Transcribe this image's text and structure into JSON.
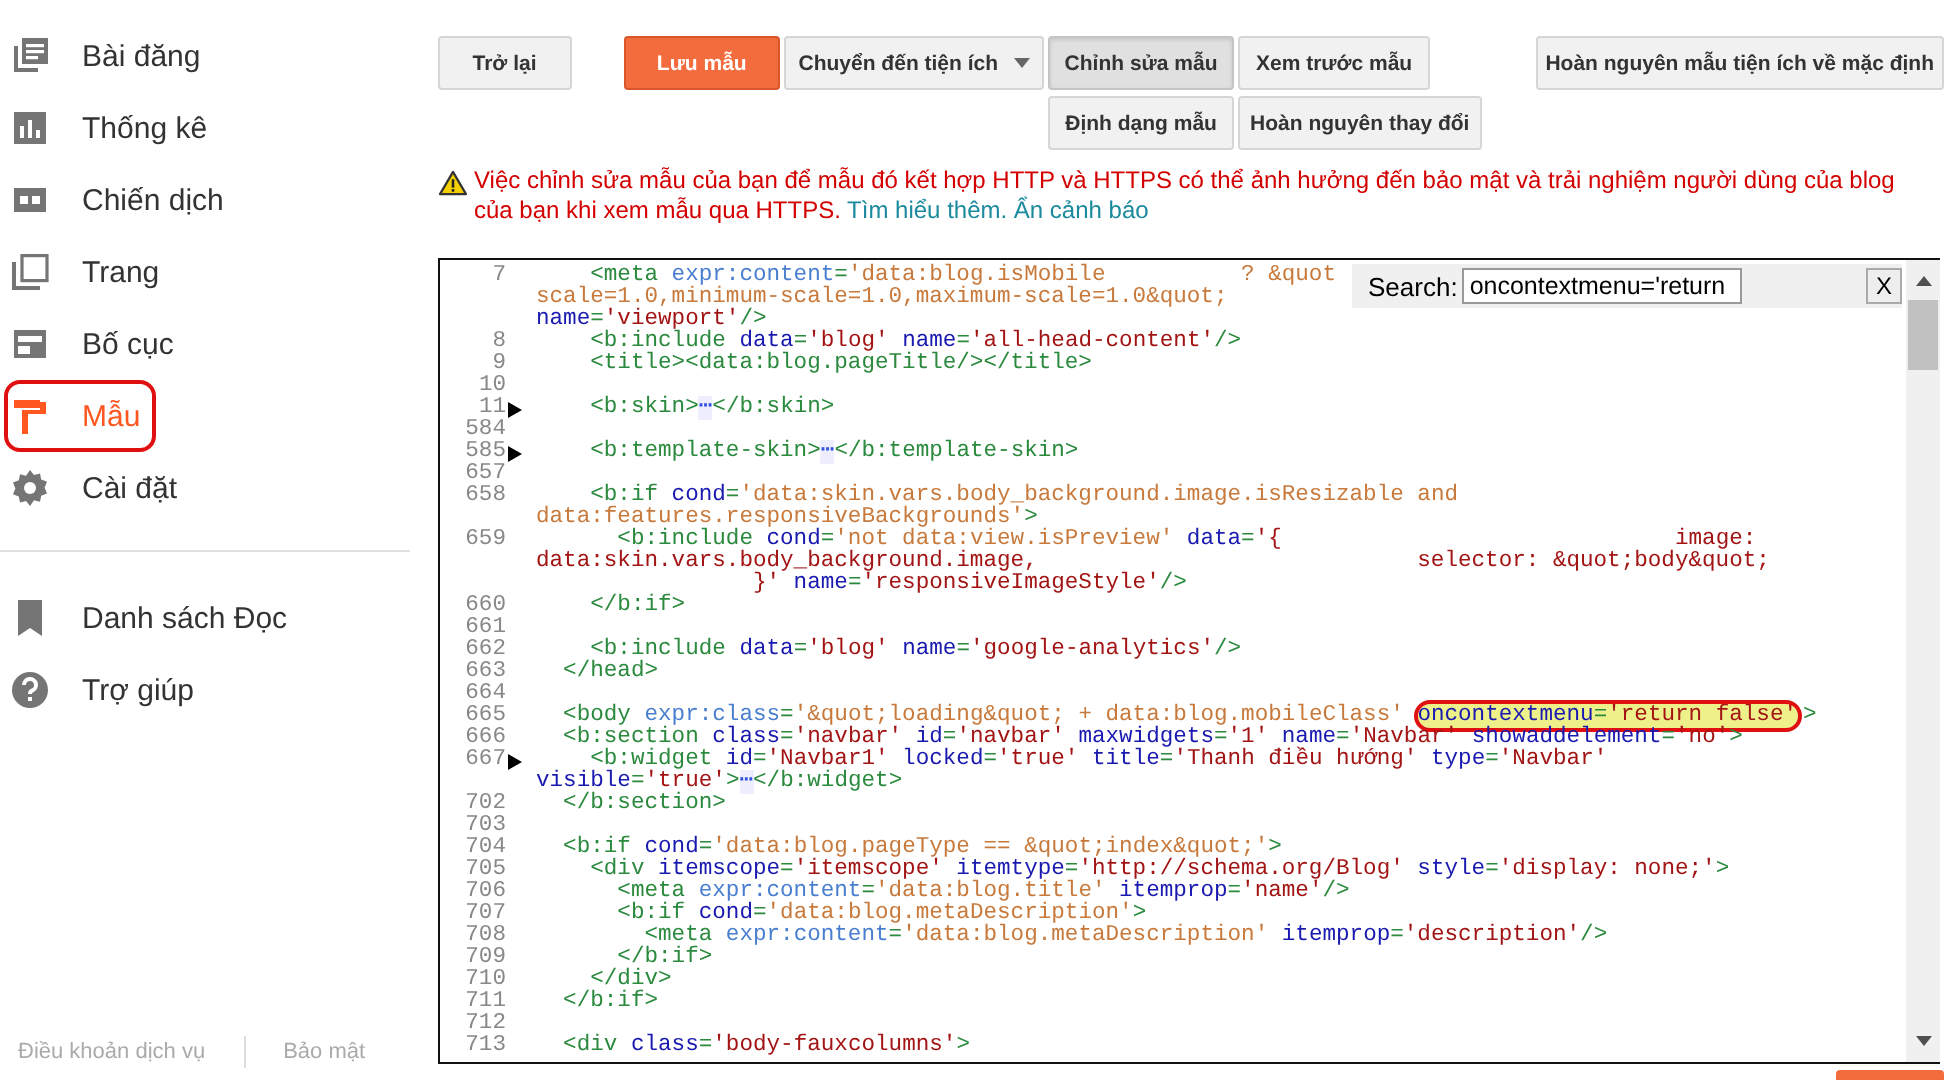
{
  "sidebar": {
    "items": [
      {
        "label": "Bài đăng",
        "selected": false,
        "circled": false
      },
      {
        "label": "Thống kê",
        "selected": false,
        "circled": false
      },
      {
        "label": "Chiến dịch",
        "selected": false,
        "circled": false
      },
      {
        "label": "Trang",
        "selected": false,
        "circled": false
      },
      {
        "label": "Bố cục",
        "selected": false,
        "circled": false
      },
      {
        "label": "Mẫu",
        "selected": true,
        "circled": true
      },
      {
        "label": "Cài đặt",
        "selected": false,
        "circled": false
      }
    ],
    "secondary_items": [
      {
        "label": "Danh sách Đọc"
      },
      {
        "label": "Trợ giúp"
      }
    ],
    "footer_links": [
      "Điều khoản dịch vụ",
      "Bảo mật"
    ]
  },
  "toolbar": {
    "back": "Trở lại",
    "save": "Lưu mẫu",
    "jump": "Chuyển đến tiện ích",
    "modes": [
      {
        "label": "Chỉnh sửa mẫu",
        "selected": true
      },
      {
        "label": "Xem trước mẫu",
        "selected": false
      }
    ],
    "format": "Định dạng mẫu",
    "revert": "Hoàn nguyên thay đổi",
    "reset_widgets": "Hoàn nguyên mẫu tiện ích về mặc định"
  },
  "warning": {
    "text": "Việc chỉnh sửa mẫu của bạn để mẫu đó kết hợp HTTP và HTTPS có thể ảnh hưởng đến bảo mật và trải nghiệm người dùng của blog của bạn khi xem mẫu qua HTTPS.",
    "learn_more": "Tìm hiểu thêm.",
    "hide": "Ẩn cảnh báo"
  },
  "search": {
    "label": "Search:",
    "value": "oncontextmenu='return",
    "close": "X"
  },
  "code_lines": [
    {
      "number": "7",
      "folded": false,
      "rows": [
        {
          "segments": [
            {
              "kind": "tag",
              "text": "    <meta"
            },
            {
              "kind": "eattr",
              "text": " expr:content"
            },
            {
              "kind": "tag",
              "text": "="
            },
            {
              "kind": "expr",
              "text": "'data:blog.isMobile          ? &quot"
            }
          ]
        },
        {
          "segments": [
            {
              "kind": "expr",
              "text": "scale=1.0,minimum-scale=1.0,maximum-scale=1.0&quot;"
            }
          ]
        },
        {
          "segments": [
            {
              "kind": "attr",
              "text": "name"
            },
            {
              "kind": "tag",
              "text": "="
            },
            {
              "kind": "str",
              "text": "'viewport'"
            },
            {
              "kind": "tag",
              "text": "/>"
            }
          ]
        }
      ]
    },
    {
      "number": "8",
      "folded": false,
      "rows": [
        {
          "segments": [
            {
              "kind": "tag",
              "text": "    <b:include"
            },
            {
              "kind": "attr",
              "text": " data"
            },
            {
              "kind": "tag",
              "text": "="
            },
            {
              "kind": "str",
              "text": "'blog'"
            },
            {
              "kind": "attr",
              "text": " name"
            },
            {
              "kind": "tag",
              "text": "="
            },
            {
              "kind": "str",
              "text": "'all-head-content'"
            },
            {
              "kind": "tag",
              "text": "/>"
            }
          ]
        }
      ]
    },
    {
      "number": "9",
      "folded": false,
      "rows": [
        {
          "segments": [
            {
              "kind": "tag",
              "text": "    <title><data:blog.pageTitle/></title>"
            }
          ]
        }
      ]
    },
    {
      "number": "10",
      "folded": false
    },
    {
      "number": "11",
      "folded": true,
      "rows": [
        {
          "segments": [
            {
              "kind": "tag",
              "text": "    <b:skin>"
            },
            {
              "kind": "fold",
              "text": "⋯"
            },
            {
              "kind": "tag",
              "text": "</b:skin>"
            }
          ]
        }
      ]
    },
    {
      "number": "584",
      "folded": false
    },
    {
      "number": "585",
      "folded": true,
      "rows": [
        {
          "segments": [
            {
              "kind": "tag",
              "text": "    <b:template-skin>"
            },
            {
              "kind": "fold",
              "text": "⋯"
            },
            {
              "kind": "tag",
              "text": "</b:template-skin>"
            }
          ]
        }
      ]
    },
    {
      "number": "657",
      "folded": false
    },
    {
      "number": "658",
      "folded": false,
      "rows": [
        {
          "segments": [
            {
              "kind": "tag",
              "text": "    <b:if"
            },
            {
              "kind": "attr",
              "text": " cond"
            },
            {
              "kind": "tag",
              "text": "="
            },
            {
              "kind": "expr",
              "text": "'data:skin.vars.body_background.image.isResizable and"
            }
          ]
        },
        {
          "segments": [
            {
              "kind": "expr",
              "text": "data:features.responsiveBackgrounds'"
            },
            {
              "kind": "tag",
              "text": ">"
            }
          ]
        }
      ]
    },
    {
      "number": "659",
      "folded": false,
      "rows": [
        {
          "segments": [
            {
              "kind": "tag",
              "text": "      <b:include"
            },
            {
              "kind": "attr",
              "text": " cond"
            },
            {
              "kind": "tag",
              "text": "="
            },
            {
              "kind": "expr",
              "text": "'not data:view.isPreview'"
            },
            {
              "kind": "attr",
              "text": " data"
            },
            {
              "kind": "tag",
              "text": "="
            },
            {
              "kind": "str",
              "text": "'{                             image:"
            }
          ]
        },
        {
          "segments": [
            {
              "kind": "str",
              "text": "data:skin.vars.body_background.image,                            selector: &quot;body&quot;"
            }
          ]
        },
        {
          "segments": [
            {
              "kind": "str",
              "text": "                }'"
            },
            {
              "kind": "attr",
              "text": " name"
            },
            {
              "kind": "tag",
              "text": "="
            },
            {
              "kind": "str",
              "text": "'responsiveImageStyle'"
            },
            {
              "kind": "tag",
              "text": "/>"
            }
          ]
        }
      ]
    },
    {
      "number": "660",
      "folded": false,
      "rows": [
        {
          "segments": [
            {
              "kind": "tag",
              "text": "    </b:if>"
            }
          ]
        }
      ]
    },
    {
      "number": "661",
      "folded": false
    },
    {
      "number": "662",
      "folded": false,
      "rows": [
        {
          "segments": [
            {
              "kind": "tag",
              "text": "    <b:include"
            },
            {
              "kind": "attr",
              "text": " data"
            },
            {
              "kind": "tag",
              "text": "="
            },
            {
              "kind": "str",
              "text": "'blog'"
            },
            {
              "kind": "attr",
              "text": " name"
            },
            {
              "kind": "tag",
              "text": "="
            },
            {
              "kind": "str",
              "text": "'google-analytics'"
            },
            {
              "kind": "tag",
              "text": "/>"
            }
          ]
        }
      ]
    },
    {
      "number": "663",
      "folded": false,
      "rows": [
        {
          "segments": [
            {
              "kind": "tag",
              "text": "  </head>"
            }
          ]
        }
      ]
    },
    {
      "number": "664",
      "folded": false
    },
    {
      "number": "665",
      "folded": false,
      "rows": [
        {
          "segments": [
            {
              "kind": "tag",
              "text": "  <body"
            },
            {
              "kind": "eattr",
              "text": " expr:class"
            },
            {
              "kind": "tag",
              "text": "="
            },
            {
              "kind": "expr",
              "text": "'&quot;loading&quot; + data:blog.mobileClass' "
            },
            {
              "kind": "match",
              "circled": true,
              "parts": [
                {
                  "kind": "attr",
                  "text": "oncontextmenu"
                },
                {
                  "kind": "tag",
                  "text": "="
                },
                {
                  "kind": "str",
                  "text": "'return false'"
                }
              ]
            },
            {
              "kind": "tag",
              "text": ">"
            }
          ]
        }
      ]
    },
    {
      "number": "666",
      "folded": false,
      "rows": [
        {
          "segments": [
            {
              "kind": "tag",
              "text": "  <b:section"
            },
            {
              "kind": "attr",
              "text": " class"
            },
            {
              "kind": "tag",
              "text": "="
            },
            {
              "kind": "str",
              "text": "'navbar'"
            },
            {
              "kind": "attr",
              "text": " id"
            },
            {
              "kind": "tag",
              "text": "="
            },
            {
              "kind": "str",
              "text": "'navbar'"
            },
            {
              "kind": "attr",
              "text": " maxwidgets"
            },
            {
              "kind": "tag",
              "text": "="
            },
            {
              "kind": "str",
              "text": "'1'"
            },
            {
              "kind": "attr",
              "text": " name"
            },
            {
              "kind": "tag",
              "text": "="
            },
            {
              "kind": "str",
              "text": "'Navbar'"
            },
            {
              "kind": "attr",
              "text": " showaddelement"
            },
            {
              "kind": "tag",
              "text": "="
            },
            {
              "kind": "str",
              "text": "'no'"
            },
            {
              "kind": "tag",
              "text": ">"
            }
          ]
        }
      ]
    },
    {
      "number": "667",
      "folded": true,
      "rows": [
        {
          "segments": [
            {
              "kind": "tag",
              "text": "    <b:widget"
            },
            {
              "kind": "attr",
              "text": " id"
            },
            {
              "kind": "tag",
              "text": "="
            },
            {
              "kind": "str",
              "text": "'Navbar1'"
            },
            {
              "kind": "attr",
              "text": " locked"
            },
            {
              "kind": "tag",
              "text": "="
            },
            {
              "kind": "str",
              "text": "'true'"
            },
            {
              "kind": "attr",
              "text": " title"
            },
            {
              "kind": "tag",
              "text": "="
            },
            {
              "kind": "str",
              "text": "'Thanh điều hướng'"
            },
            {
              "kind": "attr",
              "text": " type"
            },
            {
              "kind": "tag",
              "text": "="
            },
            {
              "kind": "str",
              "text": "'Navbar'"
            }
          ]
        },
        {
          "segments": [
            {
              "kind": "attr",
              "text": "visible"
            },
            {
              "kind": "tag",
              "text": "="
            },
            {
              "kind": "str",
              "text": "'true'"
            },
            {
              "kind": "tag",
              "text": ">"
            },
            {
              "kind": "fold",
              "text": "⋯"
            },
            {
              "kind": "tag",
              "text": "</b:widget>"
            }
          ]
        }
      ]
    },
    {
      "number": "702",
      "folded": false,
      "rows": [
        {
          "segments": [
            {
              "kind": "tag",
              "text": "  </b:section>"
            }
          ]
        }
      ]
    },
    {
      "number": "703",
      "folded": false
    },
    {
      "number": "704",
      "folded": false,
      "rows": [
        {
          "segments": [
            {
              "kind": "tag",
              "text": "  <b:if"
            },
            {
              "kind": "attr",
              "text": " cond"
            },
            {
              "kind": "tag",
              "text": "="
            },
            {
              "kind": "expr",
              "text": "'data:blog.pageType == &quot;index&quot;'"
            },
            {
              "kind": "tag",
              "text": ">"
            }
          ]
        }
      ]
    },
    {
      "number": "705",
      "folded": false,
      "rows": [
        {
          "segments": [
            {
              "kind": "tag",
              "text": "    <div"
            },
            {
              "kind": "attr",
              "text": " itemscope"
            },
            {
              "kind": "tag",
              "text": "="
            },
            {
              "kind": "str",
              "text": "'itemscope'"
            },
            {
              "kind": "attr",
              "text": " itemtype"
            },
            {
              "kind": "tag",
              "text": "="
            },
            {
              "kind": "str",
              "text": "'http://schema.org/Blog'"
            },
            {
              "kind": "attr",
              "text": " style"
            },
            {
              "kind": "tag",
              "text": "="
            },
            {
              "kind": "str",
              "text": "'display: none;'"
            },
            {
              "kind": "tag",
              "text": ">"
            }
          ]
        }
      ]
    },
    {
      "number": "706",
      "folded": false,
      "rows": [
        {
          "segments": [
            {
              "kind": "tag",
              "text": "      <meta"
            },
            {
              "kind": "eattr",
              "text": " expr:content"
            },
            {
              "kind": "tag",
              "text": "="
            },
            {
              "kind": "expr",
              "text": "'data:blog.title'"
            },
            {
              "kind": "attr",
              "text": " itemprop"
            },
            {
              "kind": "tag",
              "text": "="
            },
            {
              "kind": "str",
              "text": "'name'"
            },
            {
              "kind": "tag",
              "text": "/>"
            }
          ]
        }
      ]
    },
    {
      "number": "707",
      "folded": false,
      "rows": [
        {
          "segments": [
            {
              "kind": "tag",
              "text": "      <b:if"
            },
            {
              "kind": "attr",
              "text": " cond"
            },
            {
              "kind": "tag",
              "text": "="
            },
            {
              "kind": "expr",
              "text": "'data:blog.metaDescription'"
            },
            {
              "kind": "tag",
              "text": ">"
            }
          ]
        }
      ]
    },
    {
      "number": "708",
      "folded": false,
      "rows": [
        {
          "segments": [
            {
              "kind": "tag",
              "text": "        <meta"
            },
            {
              "kind": "eattr",
              "text": " expr:content"
            },
            {
              "kind": "tag",
              "text": "="
            },
            {
              "kind": "expr",
              "text": "'data:blog.metaDescription'"
            },
            {
              "kind": "attr",
              "text": " itemprop"
            },
            {
              "kind": "tag",
              "text": "="
            },
            {
              "kind": "str",
              "text": "'description'"
            },
            {
              "kind": "tag",
              "text": "/>"
            }
          ]
        }
      ]
    },
    {
      "number": "709",
      "folded": false,
      "rows": [
        {
          "segments": [
            {
              "kind": "tag",
              "text": "      </b:if>"
            }
          ]
        }
      ]
    },
    {
      "number": "710",
      "folded": false,
      "rows": [
        {
          "segments": [
            {
              "kind": "tag",
              "text": "    </div>"
            }
          ]
        }
      ]
    },
    {
      "number": "711",
      "folded": false,
      "rows": [
        {
          "segments": [
            {
              "kind": "tag",
              "text": "  </b:if>"
            }
          ]
        }
      ]
    },
    {
      "number": "712",
      "folded": false
    },
    {
      "number": "713",
      "folded": false,
      "rows": [
        {
          "segments": [
            {
              "kind": "tag",
              "text": "  <div"
            },
            {
              "kind": "attr",
              "text": " class"
            },
            {
              "kind": "tag",
              "text": "="
            },
            {
              "kind": "str",
              "text": "'body-fauxcolumns'"
            },
            {
              "kind": "tag",
              "text": ">"
            }
          ]
        }
      ]
    }
  ]
}
